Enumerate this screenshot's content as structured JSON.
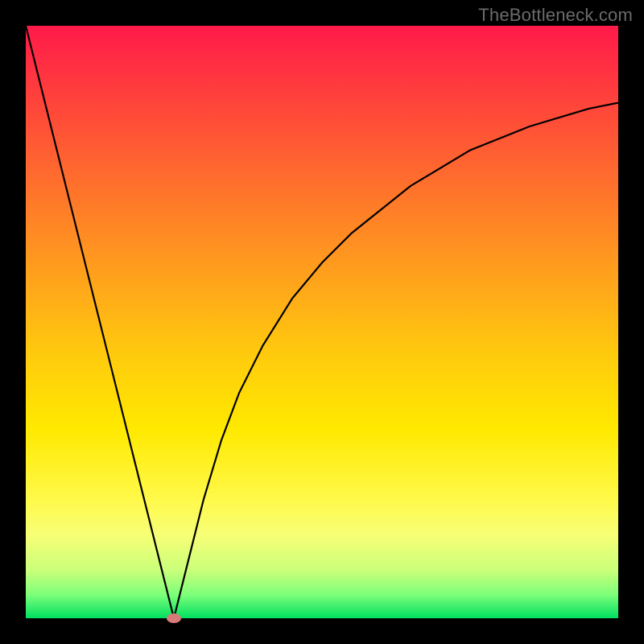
{
  "watermark": "TheBottleneck.com",
  "chart_data": {
    "type": "line",
    "title": "",
    "xlabel": "",
    "ylabel": "",
    "xlim": [
      0,
      100
    ],
    "ylim": [
      0,
      100
    ],
    "grid": false,
    "series": [
      {
        "name": "curve",
        "x": [
          0,
          5,
          10,
          15,
          20,
          22,
          24,
          25,
          26,
          28,
          30,
          33,
          36,
          40,
          45,
          50,
          55,
          60,
          65,
          70,
          75,
          80,
          85,
          90,
          95,
          100
        ],
        "values": [
          100,
          80,
          60,
          40,
          20,
          12,
          4,
          0,
          4,
          12,
          20,
          30,
          38,
          46,
          54,
          60,
          65,
          69,
          73,
          76,
          79,
          81,
          83,
          84.5,
          86,
          87
        ]
      }
    ],
    "marker": {
      "x": 25,
      "y": 0
    },
    "background_gradient": {
      "top": "#ff1a4a",
      "bottom": "#00e060"
    }
  }
}
